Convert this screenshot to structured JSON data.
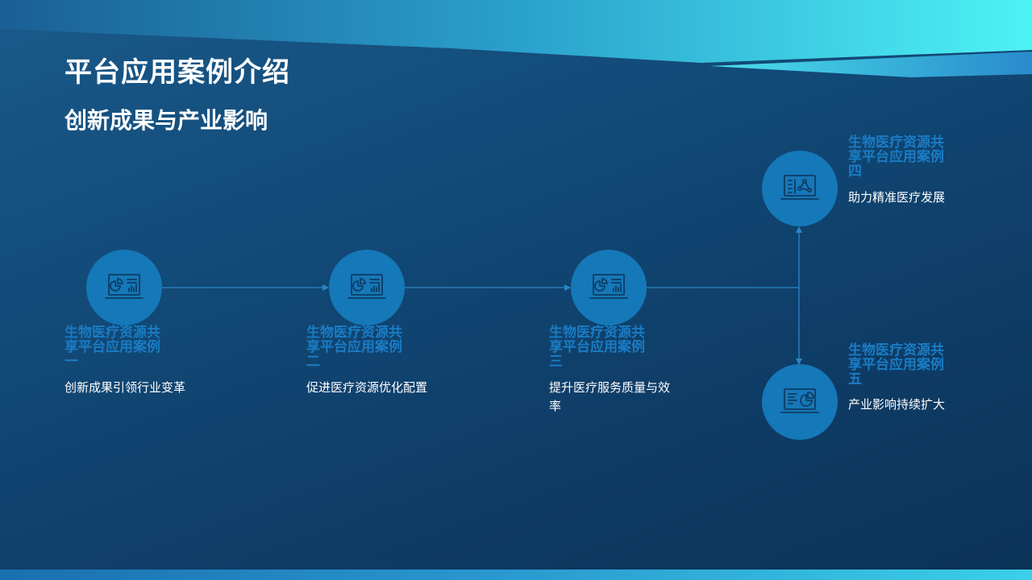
{
  "slide": {
    "title": "平台应用案例介绍",
    "subtitle": "创新成果与产业影响"
  },
  "colors": {
    "background": "#124a78",
    "node_fill": "#1578b8",
    "case_title": "#1a7cc4",
    "accent_cyan": "#4ef2f5",
    "connector": "#2a86c6"
  },
  "cases": [
    {
      "title": "生物医疗资源共享平台应用案例一",
      "description": "创新成果引领行业变革",
      "icon": "laptop-chart-icon"
    },
    {
      "title": "生物医疗资源共享平台应用案例二",
      "description": "促进医疗资源优化配置",
      "icon": "laptop-chart-icon"
    },
    {
      "title": "生物医疗资源共享平台应用案例三",
      "description": "提升医疗服务质量与效率",
      "icon": "laptop-chart-icon"
    },
    {
      "title": "生物医疗资源共享平台应用案例四",
      "description": "助力精准医疗发展",
      "icon": "laptop-network-icon"
    },
    {
      "title": "生物医疗资源共享平台应用案例五",
      "description": "产业影响持续扩大",
      "icon": "laptop-pie-icon"
    }
  ]
}
